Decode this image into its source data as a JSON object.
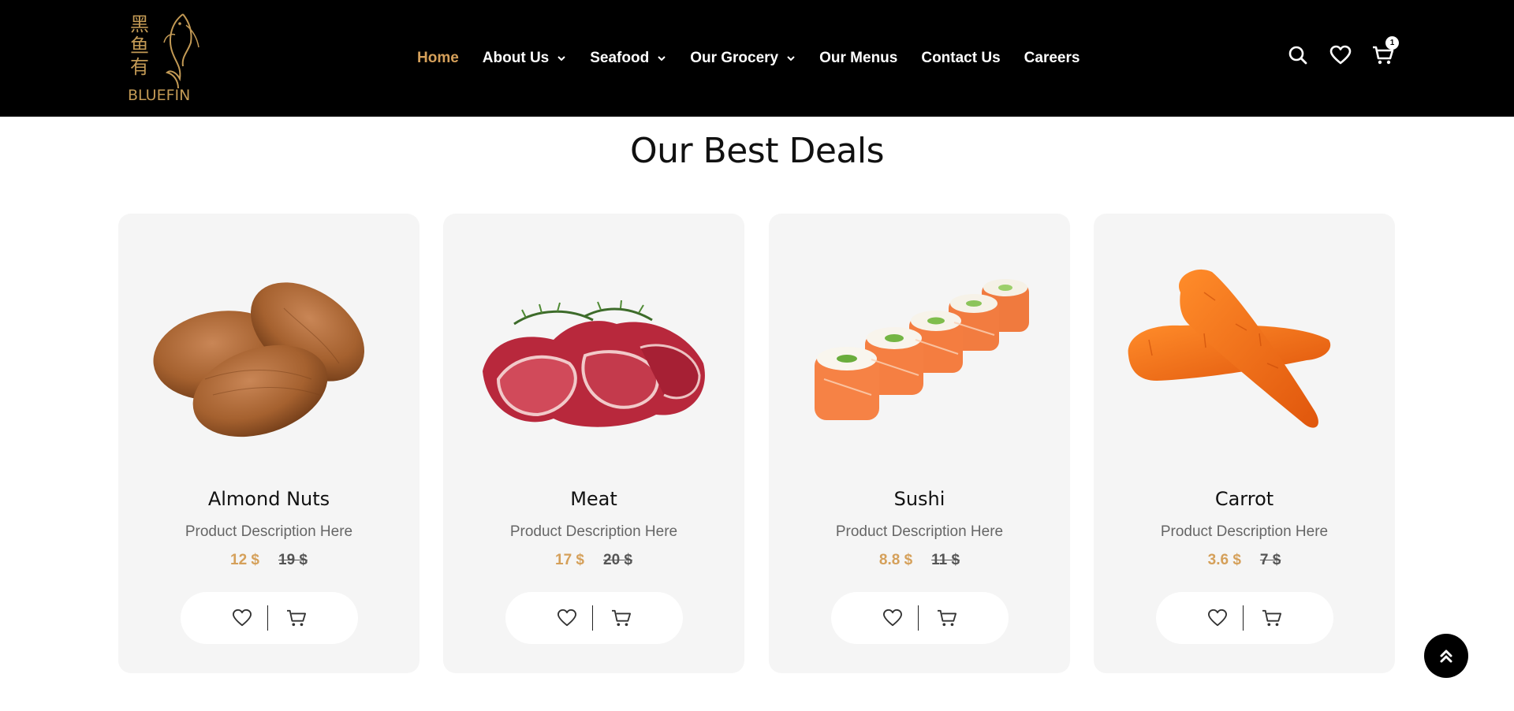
{
  "brand": {
    "logo_cjk": [
      "黑",
      "鱼",
      "有"
    ],
    "logo_word": "BLUEFIN",
    "accent_color": "#d5a05a"
  },
  "nav": {
    "items": [
      {
        "label": "Home",
        "active": true,
        "has_dropdown": false
      },
      {
        "label": "About Us",
        "active": false,
        "has_dropdown": true
      },
      {
        "label": "Seafood",
        "active": false,
        "has_dropdown": true
      },
      {
        "label": "Our Grocery",
        "active": false,
        "has_dropdown": true
      },
      {
        "label": "Our Menus",
        "active": false,
        "has_dropdown": false
      },
      {
        "label": "Contact Us",
        "active": false,
        "has_dropdown": false
      },
      {
        "label": "Careers",
        "active": false,
        "has_dropdown": false
      }
    ]
  },
  "header_icons": {
    "search": "search-icon",
    "wishlist": "heart-icon",
    "cart": "cart-icon",
    "cart_count": "1"
  },
  "section": {
    "title": "Our Best Deals"
  },
  "products": [
    {
      "name": "Almond Nuts",
      "description": "Product Description Here",
      "price": "12 $",
      "old_price": "19 $",
      "image": "almonds"
    },
    {
      "name": "Meat",
      "description": "Product Description Here",
      "price": "17 $",
      "old_price": "20 $",
      "image": "meat"
    },
    {
      "name": "Sushi",
      "description": "Product Description Here",
      "price": "8.8 $",
      "old_price": "11 $",
      "image": "sushi"
    },
    {
      "name": "Carrot",
      "description": "Product Description Here",
      "price": "3.6 $",
      "old_price": "7 $",
      "image": "carrot"
    }
  ],
  "back_to_top": "double-chevron-up-icon"
}
